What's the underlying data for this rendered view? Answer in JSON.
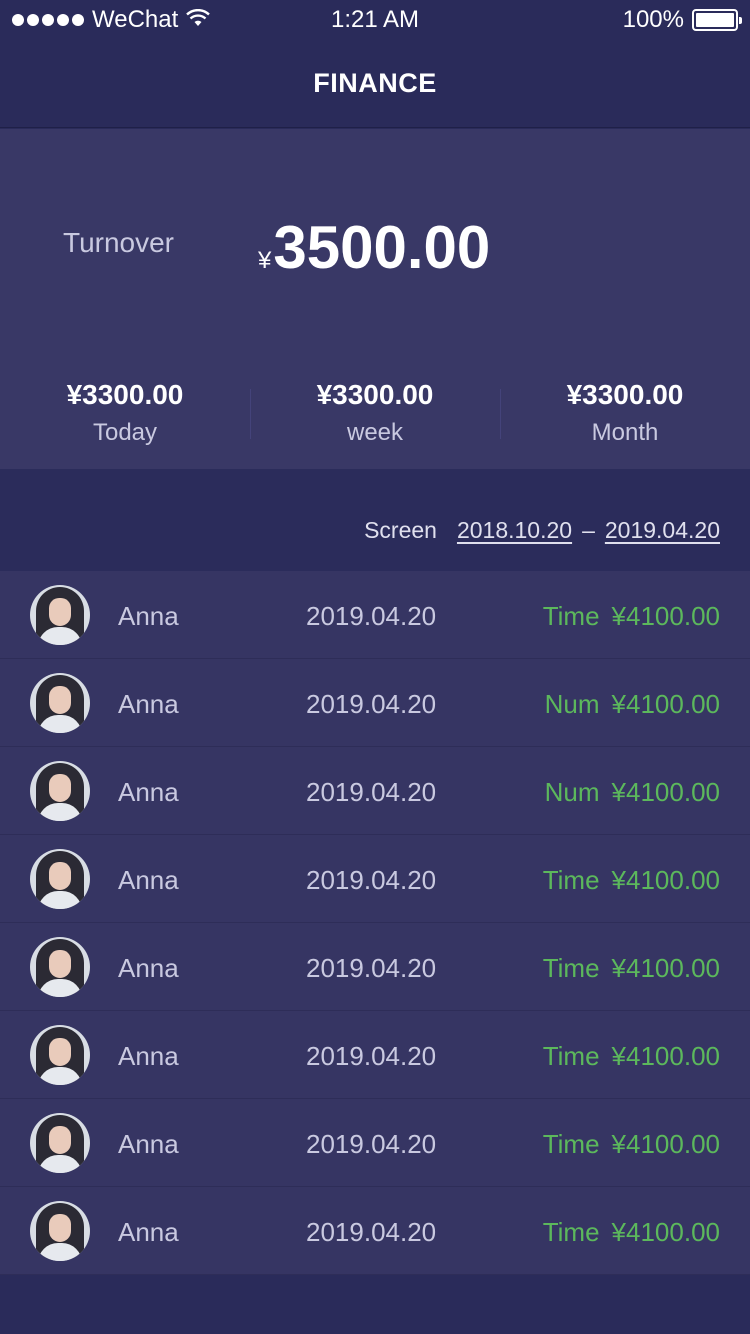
{
  "status_bar": {
    "carrier": "WeChat",
    "time": "1:21 AM",
    "battery": "100%"
  },
  "nav": {
    "title": "FINANCE"
  },
  "summary": {
    "turnover_label": "Turnover",
    "turnover_currency": "¥",
    "turnover_amount": "3500.00",
    "stats": [
      {
        "value": "¥3300.00",
        "label": "Today"
      },
      {
        "value": "¥3300.00",
        "label": "week"
      },
      {
        "value": "¥3300.00",
        "label": "Month"
      }
    ]
  },
  "filter": {
    "label": "Screen",
    "date_from": "2018.10.20",
    "separator": "–",
    "date_to": "2019.04.20"
  },
  "records": [
    {
      "name": "Anna",
      "date": "2019.04.20",
      "type": "Time",
      "amount": "¥4100.00"
    },
    {
      "name": "Anna",
      "date": "2019.04.20",
      "type": "Num",
      "amount": "¥4100.00"
    },
    {
      "name": "Anna",
      "date": "2019.04.20",
      "type": "Num",
      "amount": "¥4100.00"
    },
    {
      "name": "Anna",
      "date": "2019.04.20",
      "type": "Time",
      "amount": "¥4100.00"
    },
    {
      "name": "Anna",
      "date": "2019.04.20",
      "type": "Time",
      "amount": "¥4100.00"
    },
    {
      "name": "Anna",
      "date": "2019.04.20",
      "type": "Time",
      "amount": "¥4100.00"
    },
    {
      "name": "Anna",
      "date": "2019.04.20",
      "type": "Time",
      "amount": "¥4100.00"
    },
    {
      "name": "Anna",
      "date": "2019.04.20",
      "type": "Time",
      "amount": "¥4100.00"
    }
  ],
  "colors": {
    "background": "#2a2b5a",
    "card": "#393866",
    "row": "#363563",
    "accent_green": "#5cb85c"
  }
}
